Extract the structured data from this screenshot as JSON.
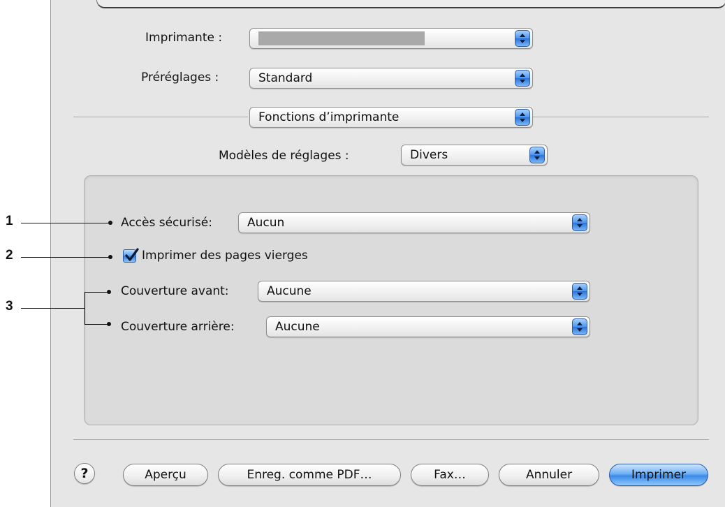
{
  "dialog": {
    "printer": {
      "label": "Imprimante :",
      "value": ""
    },
    "presets": {
      "label": "Préréglages :",
      "value": "Standard"
    },
    "panel_select": {
      "value": "Fonctions d’imprimante"
    },
    "settings_models": {
      "label": "Modèles de réglages :",
      "value": "Divers"
    }
  },
  "options": {
    "secure_access": {
      "label": "Accès sécurisé:",
      "value": "Aucun"
    },
    "blank_pages": {
      "label": "Imprimer des pages vierges",
      "checked": true
    },
    "front_cover": {
      "label": "Couverture avant:",
      "value": "Aucune"
    },
    "back_cover": {
      "label": "Couverture arrière:",
      "value": "Aucune"
    }
  },
  "callouts": {
    "one": "1",
    "two": "2",
    "three": "3"
  },
  "buttons": {
    "help": "?",
    "preview": "Aperçu",
    "save_pdf": "Enreg. comme PDF…",
    "fax": "Fax…",
    "cancel": "Annuler",
    "print": "Imprimer"
  },
  "icons": {
    "popup_stepper": "up-down-arrows-icon",
    "checkbox": "checkmark-icon"
  },
  "colors": {
    "accent_blue": "#3b8ae8",
    "panel_gray": "#dbdbdb",
    "dialog_gray": "#e6e6e6"
  }
}
